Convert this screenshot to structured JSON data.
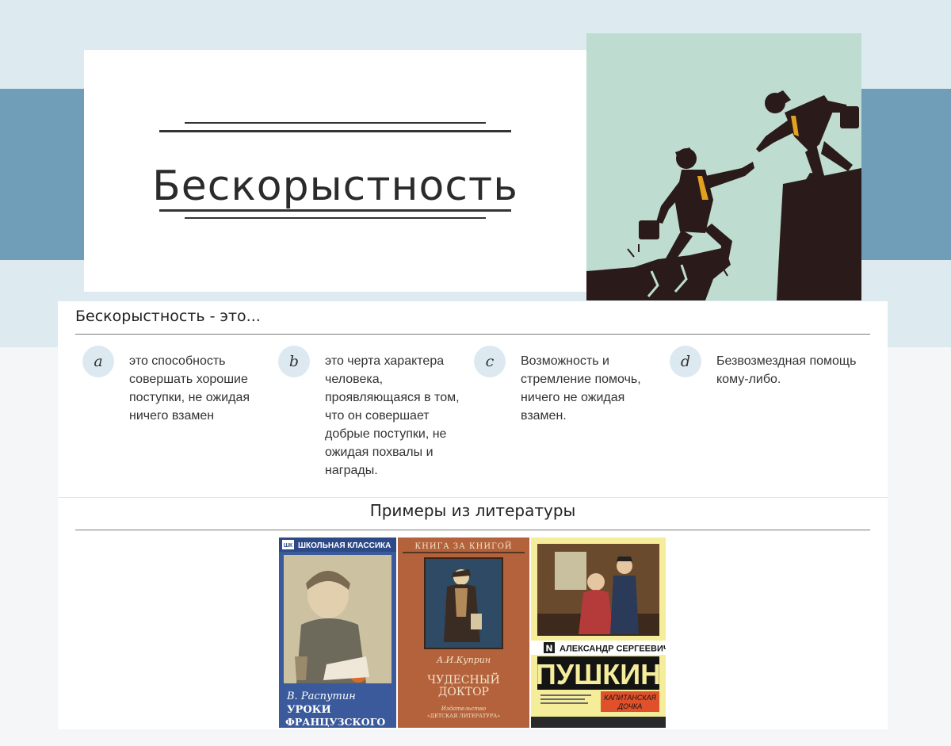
{
  "header": {
    "title": "Бескорыстность"
  },
  "hero": {
    "icon": "helping-hand-cliff-illustration",
    "background_color": "#bedcd0"
  },
  "definitions": {
    "heading": "Бескорыстность - это...",
    "items": [
      {
        "letter": "a",
        "text": "это способность совершать хорошие поступки, не ожидая ничего взамен"
      },
      {
        "letter": "b",
        "text": "это черта характера человека, проявляющаяся в том, что он совершает добрые поступки, не ожидая похвалы и награды."
      },
      {
        "letter": "c",
        "text": "Возможность и стремление помочь, ничего не ожидая взамен."
      },
      {
        "letter": "d",
        "text": "Безвозмездная помощь кому-либо."
      }
    ]
  },
  "literature": {
    "heading": "Примеры из литературы",
    "books": [
      {
        "series": "ШКОЛЬНАЯ КЛАССИКА",
        "series_mark": "ШК",
        "author": "В. Распутин",
        "title": "УРОКИ ФРАНЦУЗСКОГО"
      },
      {
        "series": "КНИГА ЗА КНИГОЙ",
        "author": "А.И.Куприн",
        "title_line1": "ЧУДЕСНЫЙ",
        "title_line2": "ДОКТОР",
        "publisher_line1": "Издательство",
        "publisher_line2": "«ДЕТСКАЯ ЛИТЕРАТУРА»"
      },
      {
        "series_mark": "N",
        "author": "АЛЕКСАНДР СЕРГЕЕВИЧ",
        "author_surname": "ПУШКИН",
        "title_line1": "КАПИТАНСКАЯ",
        "title_line2": "ДОЧКА"
      }
    ]
  },
  "colors": {
    "page_background": "#f4f6f8",
    "band_light": "#ddeaf0",
    "band_dark": "#709eb8",
    "badge": "#dde9f0",
    "silhouette": "#2b1a1a",
    "tie": "#e2a11f"
  }
}
